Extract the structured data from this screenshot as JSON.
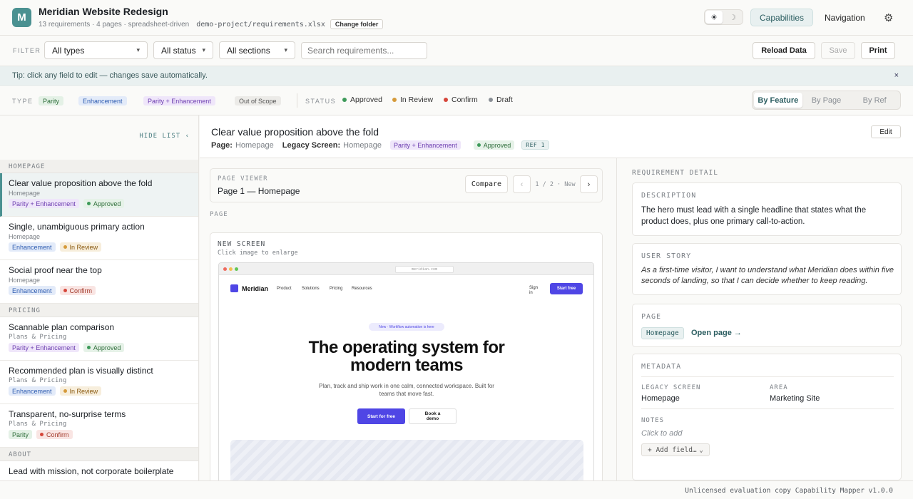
{
  "header": {
    "logo_letter": "M",
    "title": "Meridian Website Redesign",
    "subtitle": "13 requirements · 4 pages · spreadsheet-driven",
    "path": "demo-project/requirements.xlsx",
    "change_folder": "Change folder",
    "theme_light_icon": "☀",
    "theme_dark_icon": "☽",
    "tabs": [
      "Capabilities",
      "Navigation"
    ],
    "active_tab": "Capabilities",
    "gear_icon": "⚙"
  },
  "filter": {
    "label": "FILTER",
    "type_select": "All types",
    "status_select": "All status",
    "section_select": "All sections",
    "search_placeholder": "Search requirements...",
    "reload": "Reload Data",
    "save": "Save",
    "print": "Print"
  },
  "tip": {
    "text": "Tip: click any field to edit — changes save automatically.",
    "close": "×"
  },
  "legend": {
    "type_label": "TYPE",
    "types": [
      "Parity",
      "Enhancement",
      "Parity + Enhancement",
      "Out of Scope"
    ],
    "status_label": "STATUS",
    "statuses": [
      {
        "label": "Approved",
        "color": "#3e9a5a"
      },
      {
        "label": "In Review",
        "color": "#d59a3a"
      },
      {
        "label": "Confirm",
        "color": "#d6463a"
      },
      {
        "label": "Draft",
        "color": "#8a8f95"
      }
    ],
    "views": [
      "By Feature",
      "By Page",
      "By Ref"
    ],
    "active_view": "By Feature"
  },
  "sidebar": {
    "hide_list": "HIDE LIST ‹",
    "sections": [
      {
        "name": "HOMEPAGE",
        "items": [
          {
            "title": "Clear value proposition above the fold",
            "page": "Homepage",
            "type": "Parity + Enhancement",
            "status": "Approved"
          },
          {
            "title": "Single, unambiguous primary action",
            "page": "Homepage",
            "type": "Enhancement",
            "status": "In Review"
          },
          {
            "title": "Social proof near the top",
            "page": "Homepage",
            "type": "Enhancement",
            "status": "Confirm"
          }
        ]
      },
      {
        "name": "PRICING",
        "items": [
          {
            "title": "Scannable plan comparison",
            "page": "Plans & Pricing",
            "type": "Parity + Enhancement",
            "status": "Approved"
          },
          {
            "title": "Recommended plan is visually distinct",
            "page": "Plans & Pricing",
            "type": "Enhancement",
            "status": "In Review"
          },
          {
            "title": "Transparent, no-surprise terms",
            "page": "Plans & Pricing",
            "type": "Parity",
            "status": "Confirm"
          }
        ]
      },
      {
        "name": "ABOUT",
        "items": [
          {
            "title": "Lead with mission, not corporate boilerplate",
            "page": "",
            "type": "",
            "status": ""
          }
        ]
      }
    ]
  },
  "detail": {
    "title": "Clear value proposition above the fold",
    "page_label": "Page:",
    "page_value": "Homepage",
    "legacy_label": "Legacy Screen:",
    "legacy_value": "Homepage",
    "type": "Parity + Enhancement",
    "status": "Approved",
    "ref": "REF 1",
    "edit": "Edit"
  },
  "viewer": {
    "label": "PAGE VIEWER",
    "title": "Page 1 — Homepage",
    "compare": "Compare",
    "prev": "‹",
    "next": "›",
    "pager": "1 / 2 · New",
    "page_label": "PAGE",
    "screen_label": "NEW SCREEN",
    "screen_hint": "Click image to enlarge"
  },
  "mock": {
    "url": "meridian.com",
    "brand": "Meridian",
    "nav": [
      "Product",
      "Solutions",
      "Pricing",
      "Resources"
    ],
    "sign_in": "Sign in",
    "start_free": "Start free",
    "pill": "New · Workflow automation is here",
    "headline": "The operating system for modern teams",
    "paragraph": "Plan, track and ship work in one calm, connected workspace. Built for teams that move fast.",
    "cta_primary": "Start for free",
    "cta_secondary": "Book a demo"
  },
  "requirement": {
    "label": "REQUIREMENT DETAIL",
    "description_label": "DESCRIPTION",
    "description": "The hero must lead with a single headline that states what the product does, plus one primary call-to-action.",
    "story_label": "USER STORY",
    "story": "As a first-time visitor, I want to understand what Meridian does within five seconds of landing, so that I can decide whether to keep reading.",
    "page_label": "PAGE",
    "page_chip": "Homepage",
    "open_page": "Open page →",
    "metadata_label": "METADATA",
    "legacy_label": "LEGACY SCREEN",
    "legacy_value": "Homepage",
    "area_label": "AREA",
    "area_value": "Marketing Site",
    "notes_label": "NOTES",
    "notes_placeholder": "Click to add",
    "add_field": "+ Add field…"
  },
  "footer": {
    "text": "Unlicensed evaluation copy  Capability Mapper v1.0.0"
  },
  "colors": {
    "accent": "#4a9191",
    "mock_brand": "#4f46e5"
  }
}
